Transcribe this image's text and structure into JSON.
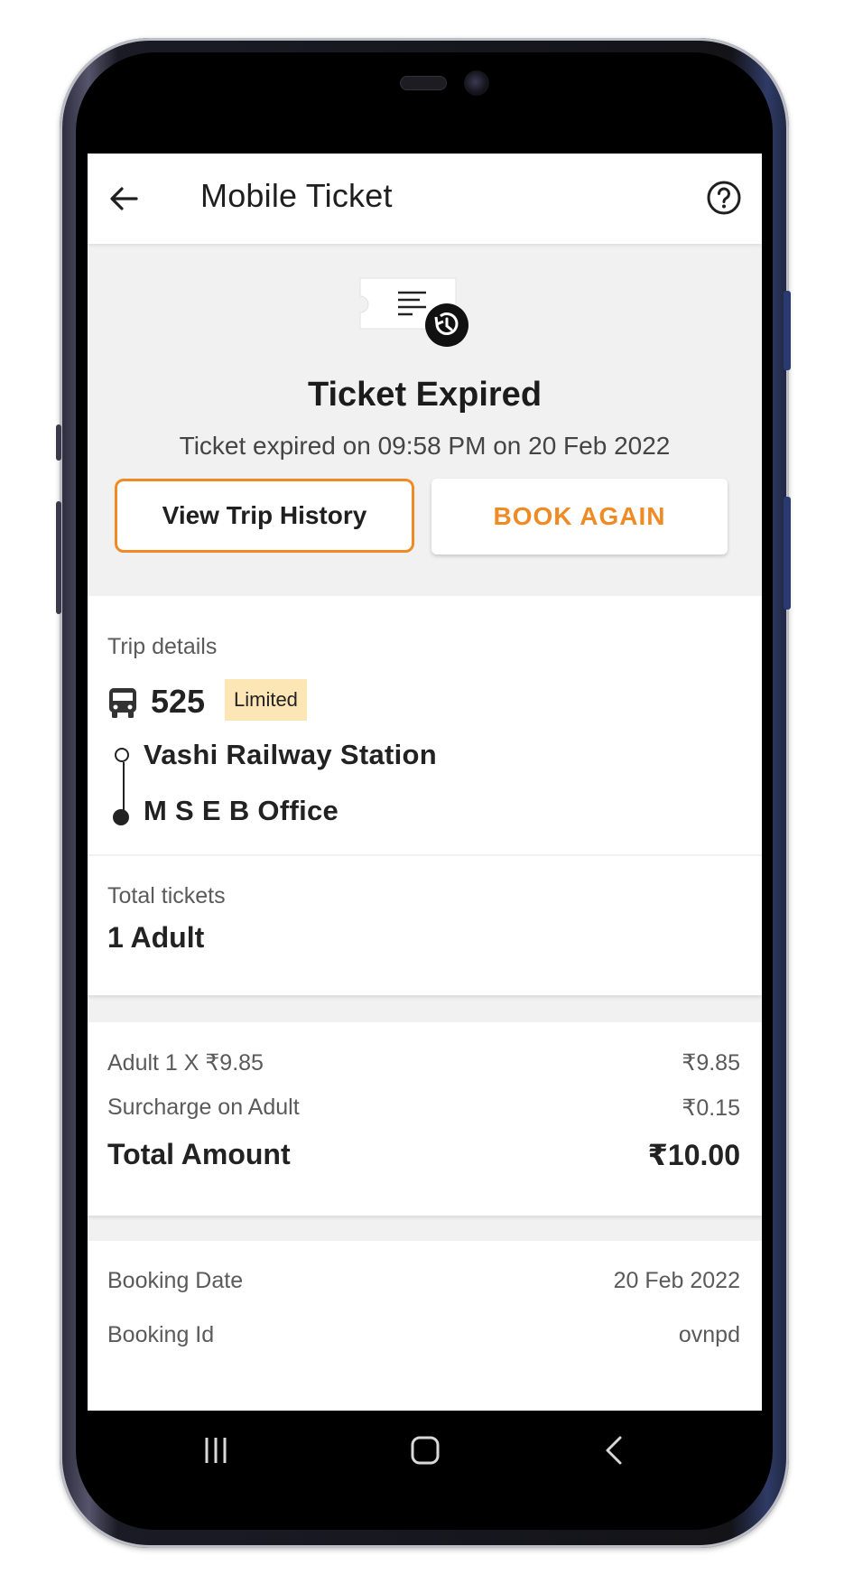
{
  "app_bar": {
    "title": "Mobile Ticket",
    "back_icon": "arrow-left-icon",
    "help_icon": "help-circle-icon"
  },
  "status": {
    "title": "Ticket Expired",
    "subtitle": "Ticket expired on 09:58 PM on 20 Feb 2022",
    "illustration_icon": "ticket-history-icon"
  },
  "actions": {
    "view_history": "View Trip History",
    "book_again": "BOOK AGAIN"
  },
  "trip": {
    "label": "Trip details",
    "route_number": "525",
    "badge": "Limited",
    "from": "Vashi Railway Station",
    "to": "M S E B Office"
  },
  "tickets": {
    "label": "Total tickets",
    "value": "1 Adult"
  },
  "fare": {
    "adult_label": "Adult 1 X ₹9.85",
    "adult_value": "₹9.85",
    "surcharge_label": "Surcharge on Adult",
    "surcharge_value": "₹0.15",
    "total_label": "Total Amount",
    "total_value": "₹10.00"
  },
  "booking": {
    "date_label": "Booking Date",
    "date_value": "20 Feb 2022",
    "id_label": "Booking Id",
    "id_value": "ovnpd"
  },
  "colors": {
    "accent": "#f08a24",
    "badge_bg": "#fde6b6",
    "screen_bg": "#f1f1f1"
  },
  "system_nav": {
    "recents_icon": "recents-icon",
    "home_icon": "home-icon",
    "back_icon": "nav-back-icon"
  }
}
